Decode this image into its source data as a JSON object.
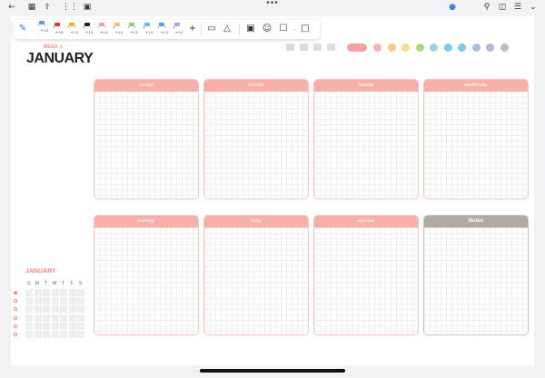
{
  "toolbar": {
    "icons": [
      "back-arrow-icon",
      "grid-view-icon",
      "export-icon",
      "apps-icon",
      "thumbnail-icon"
    ],
    "right_icons": [
      "microphone-icon",
      "search-icon",
      "add-page-icon",
      "list-icon",
      "chevron-down-icon"
    ]
  },
  "pen_tools": {
    "pens": [
      {
        "size": "1.5",
        "color": "#4aa3e0"
      },
      {
        "size": "1.5",
        "color": "#e53935"
      },
      {
        "size": "2.0",
        "color": "#f4b400"
      },
      {
        "size": "1.5",
        "color": "#222222"
      },
      {
        "size": "1.0",
        "color": "#f4a0a0"
      },
      {
        "size": "1.0",
        "color": "#f7c06a"
      },
      {
        "size": "2.0",
        "color": "#9ccc65"
      },
      {
        "size": "1.5",
        "color": "#4fc3f7"
      },
      {
        "size": "1.0",
        "color": "#42a5f5"
      },
      {
        "size": "1.0",
        "color": "#b39ddb"
      }
    ],
    "selected_pen_size": "1.5"
  },
  "header": {
    "week": "WEEK 1",
    "month": "JANUARY"
  },
  "palette": {
    "pill_color": "#f4a0a0",
    "swatches": [
      "#f4a0a0",
      "#f7c06a",
      "#f5d56a",
      "#9ccc65",
      "#80cbc4",
      "#4fc3f7",
      "#64b5f6",
      "#9fa8da",
      "#b39ddb",
      "#b0b0b0"
    ]
  },
  "days": [
    {
      "label": "sunday"
    },
    {
      "label": "monday"
    },
    {
      "label": "tuesday"
    },
    {
      "label": "wednesday"
    },
    {
      "label": "thursday"
    },
    {
      "label": "friday"
    },
    {
      "label": "saturday"
    },
    {
      "label": "Notes"
    }
  ],
  "mini_calendar": {
    "title": "JANUARY",
    "weekdays": [
      "S",
      "M",
      "T",
      "W",
      "T",
      "F",
      "S"
    ]
  }
}
